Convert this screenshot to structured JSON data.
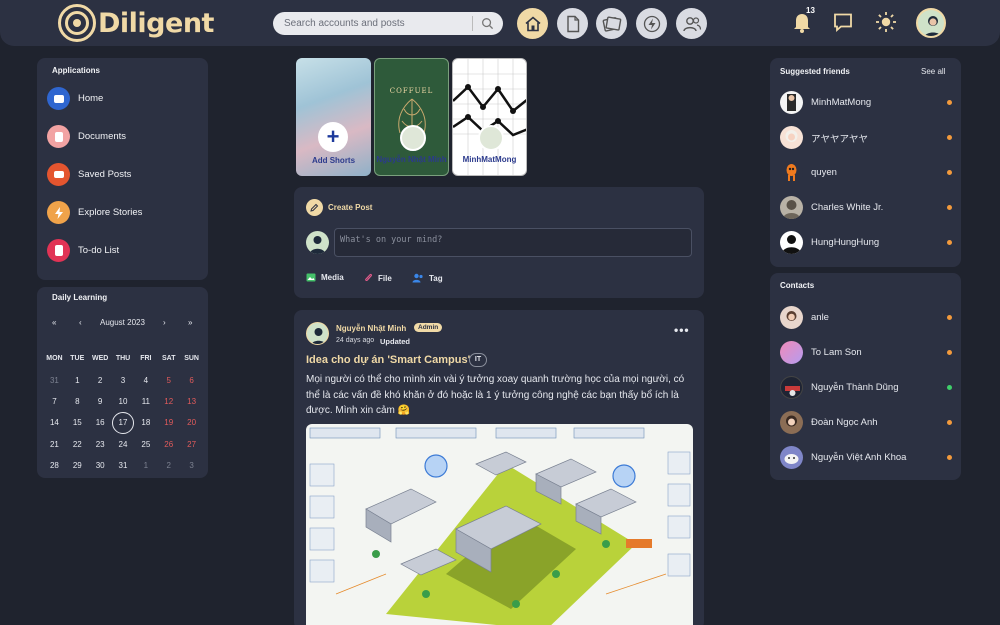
{
  "app": {
    "brand": "Diligent"
  },
  "search": {
    "placeholder": "Search accounts and posts"
  },
  "nav": {
    "items": [
      "home-icon",
      "document-icon",
      "saved-posts-icon",
      "explore-stories-icon",
      "people-icon"
    ],
    "active": "home-icon"
  },
  "header": {
    "notification_count": "13"
  },
  "colors": {
    "accent": "#f0d9a6",
    "panel": "#2c3142",
    "background": "#1f232e",
    "status_away": "#f39a3c",
    "status_online": "#3fcf6a",
    "weekend": "#e25b5b"
  },
  "applications": {
    "title": "Applications",
    "items": [
      {
        "label": "Home",
        "icon": "home-icon",
        "color": "#2f66d0"
      },
      {
        "label": "Documents",
        "icon": "document-icon",
        "color": "#f2a3a3"
      },
      {
        "label": "Saved Posts",
        "icon": "saved-posts-icon",
        "color": "#e4552f"
      },
      {
        "label": "Explore Stories",
        "icon": "lightning-icon",
        "color": "#f0a34a"
      },
      {
        "label": "To-do List",
        "icon": "clipboard-icon",
        "color": "#e13355"
      }
    ]
  },
  "calendar": {
    "title": "Daily Learning",
    "month_label": "August 2023",
    "nav": {
      "first": "«",
      "prev": "‹",
      "next": "›",
      "last": "»"
    },
    "weekdays": [
      "MON",
      "TUE",
      "WED",
      "THU",
      "FRI",
      "SAT",
      "SUN"
    ],
    "weeks": [
      [
        "31",
        "1",
        "2",
        "3",
        "4",
        "5",
        "6"
      ],
      [
        "7",
        "8",
        "9",
        "10",
        "11",
        "12",
        "13"
      ],
      [
        "14",
        "15",
        "16",
        "17",
        "18",
        "19",
        "20"
      ],
      [
        "21",
        "22",
        "23",
        "24",
        "25",
        "26",
        "27"
      ],
      [
        "28",
        "29",
        "30",
        "31",
        "1",
        "2",
        "3"
      ]
    ],
    "today": "17"
  },
  "shorts": {
    "add_label": "Add Shorts",
    "add_symbol": "+",
    "items": [
      {
        "name": "Nguyễn Nhật Minh",
        "poster_text": "COFFUEL"
      },
      {
        "name": "MinhMatMong"
      }
    ]
  },
  "create_post": {
    "title": "Create Post",
    "placeholder": "What's on your mind?",
    "actions": [
      {
        "label": "Media",
        "icon": "image-icon",
        "color": "#45c06a"
      },
      {
        "label": "File",
        "icon": "paperclip-icon",
        "color": "#e25b8a"
      },
      {
        "label": "Tag",
        "icon": "people-tag-icon",
        "color": "#3a86e8"
      }
    ]
  },
  "post": {
    "author": "Nguyễn Nhật Minh",
    "role": "Admin",
    "time": "24 days ago",
    "status": "Updated",
    "title": "Idea cho dự án 'Smart Campus'",
    "tag": "IT",
    "body": "Mọi người có thể cho mình xin vài ý tưởng xoay quanh trường học của mọi người, có thể là các vấn đề khó khăn ở đó hoặc là 1 ý tưởng công nghệ các bạn thấy bổ ích là được. Mình xin cảm 🤗",
    "menu_icon": "more-icon"
  },
  "suggested": {
    "title": "Suggested friends",
    "see_all": "See all",
    "items": [
      {
        "name": "MinhMatMong",
        "online": false,
        "avatar_color": "#f4f4f4"
      },
      {
        "name": "アヤヤアヤヤ",
        "online": false,
        "avatar_color": "#f7e2d6"
      },
      {
        "name": "quyen",
        "online": false,
        "avatar_color": "#2c3142"
      },
      {
        "name": "Charles White Jr.",
        "online": false,
        "avatar_color": "#b9b2a6"
      },
      {
        "name": "HungHungHung",
        "online": false,
        "avatar_color": "#ffffff"
      }
    ]
  },
  "contacts": {
    "title": "Contacts",
    "items": [
      {
        "name": "anle",
        "online": false,
        "avatar_color": "#e8d6cc"
      },
      {
        "name": "To Lam Son",
        "online": false,
        "avatar_color": "#e89acb"
      },
      {
        "name": "Nguyễn Thành Dũng",
        "online": true,
        "avatar_color": "#1f2433"
      },
      {
        "name": "Đoàn Ngọc Anh",
        "online": false,
        "avatar_color": "#8b6d55"
      },
      {
        "name": "Nguyễn Việt Anh Khoa",
        "online": false,
        "avatar_color": "#7f86c8"
      }
    ]
  }
}
